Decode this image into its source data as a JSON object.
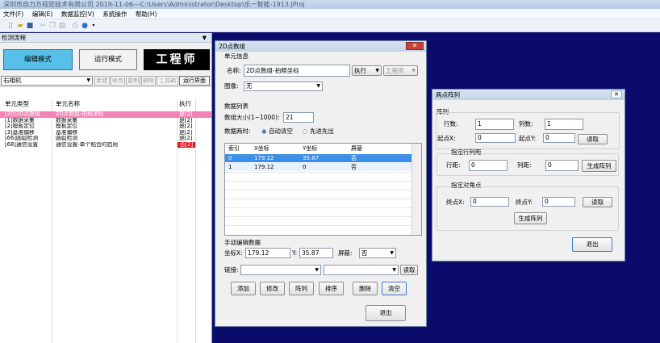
{
  "window": {
    "title": "深圳市自力方视觉技术有限公司  2019-11-06---C:\\Users\\Administrator\\Desktop\\乐一智能-1913.JProj"
  },
  "menu": [
    "文件(F)",
    "编辑(E)",
    "数据监控(V)",
    "系统操作",
    "帮助(H)"
  ],
  "left_panel": {
    "title": "检测流程",
    "edit_mode": "编辑模式",
    "run_mode": "运行模式",
    "role": "工程师",
    "camera": "右相机",
    "tools": [
      "新建",
      "修改",
      "复制",
      "删除",
      "工具箱",
      "运行界面"
    ],
    "columns": [
      "单元类型",
      "单元名称",
      "执行"
    ],
    "rows": [
      {
        "type": "[20]2D点数组",
        "name": "2D点数组-拍照坐标",
        "exec": "是[2]"
      },
      {
        "type": "[1]数据采集",
        "name": "数据采集",
        "exec": "是[2]"
      },
      {
        "type": "[2]模板定位",
        "name": "模板定位",
        "exec": "是[2]"
      },
      {
        "type": "[3]基准偏移",
        "name": "基准偏移",
        "exec": "是[2]"
      },
      {
        "type": "[66]圆弧检测",
        "name": "圆弧检测",
        "exec": "是[2]"
      },
      {
        "type": "[68]通信设置",
        "name": "通信设置-单个粘合时启用",
        "exec": "否[2]"
      }
    ]
  },
  "dlg2d": {
    "title": "2D点数组",
    "unit_info": "单元信息",
    "name_label": "名称:",
    "name_value": "2D点数组-拍照坐标",
    "exec_label": "执行",
    "role_label": "工程师",
    "image_label": "图像:",
    "image_value": "无",
    "data_list": "数据列表",
    "array_size_label": "数组大小(1~1000):",
    "array_size": "21",
    "data_sync_label": "数据两时:",
    "radio_auto": "自动清空",
    "radio_fifo": "先进先出",
    "table_cols": [
      "索引",
      "X坐标",
      "Y坐标",
      "屏蔽"
    ],
    "table_rows": [
      {
        "idx": "0",
        "x": "179.12",
        "y": "35.87",
        "mask": "否"
      },
      {
        "idx": "1",
        "x": "179.12",
        "y": "0",
        "mask": "否"
      }
    ],
    "manual_edit": "手动编辑数据",
    "coord_x_label": "坐标X:",
    "coord_x": "179.12",
    "coord_y_label": "Y:",
    "coord_y": "35.87",
    "mask_label": "屏蔽:",
    "mask_value": "否",
    "link_label": "链接:",
    "read_btn": "读取",
    "buttons": [
      "添加",
      "修改",
      "阵列",
      "排序",
      "删除",
      "清空"
    ],
    "exit": "退出"
  },
  "dlgarr": {
    "title": "两点阵列",
    "array": "阵列",
    "rows_label": "行数:",
    "rows_value": "1",
    "cols_label": "列数:",
    "cols_value": "1",
    "start_x_label": "起点X:",
    "start_x": "0",
    "start_y_label": "起点Y:",
    "start_y": "0",
    "read1": "读取",
    "spacing_group": "指定行列距",
    "row_dist_label": "行距:",
    "row_dist": "0",
    "col_dist_label": "列距:",
    "col_dist": "0",
    "gen1": "生成阵列",
    "diag_group": "指定对角点",
    "end_x_label": "终点X:",
    "end_x": "0",
    "end_y_label": "终点Y:",
    "end_y": "0",
    "read2": "读取",
    "gen2": "生成阵列",
    "exit": "退出"
  }
}
